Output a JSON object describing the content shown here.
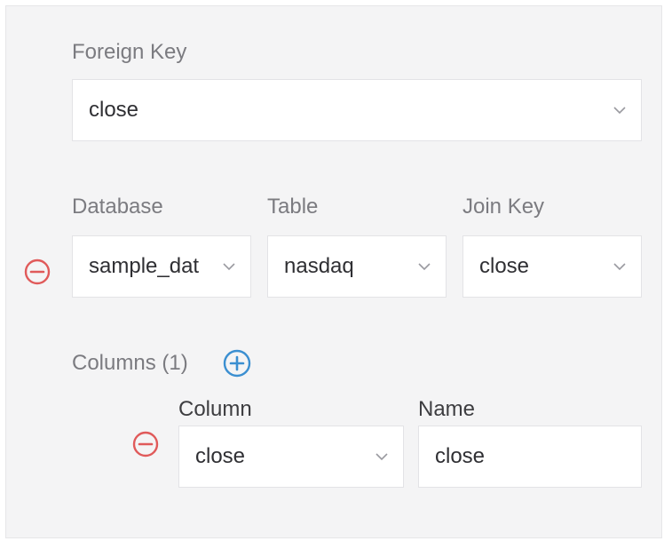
{
  "foreign_key": {
    "label": "Foreign Key",
    "value": "close"
  },
  "join": {
    "database_label": "Database",
    "table_label": "Table",
    "join_key_label": "Join Key",
    "database_value": "sample_dat",
    "table_value": "nasdaq",
    "join_key_value": "close"
  },
  "columns": {
    "header": "Columns (1)",
    "column_label": "Column",
    "name_label": "Name",
    "rows": [
      {
        "column": "close",
        "name": "close"
      }
    ]
  },
  "colors": {
    "remove": "#e05a5a",
    "add": "#3b8fd1",
    "label_text": "#7b7b80",
    "panel_bg": "#f4f4f5"
  },
  "icons": {
    "remove": "minus-circle-icon",
    "add": "plus-circle-icon",
    "dropdown": "chevron-down-icon"
  }
}
